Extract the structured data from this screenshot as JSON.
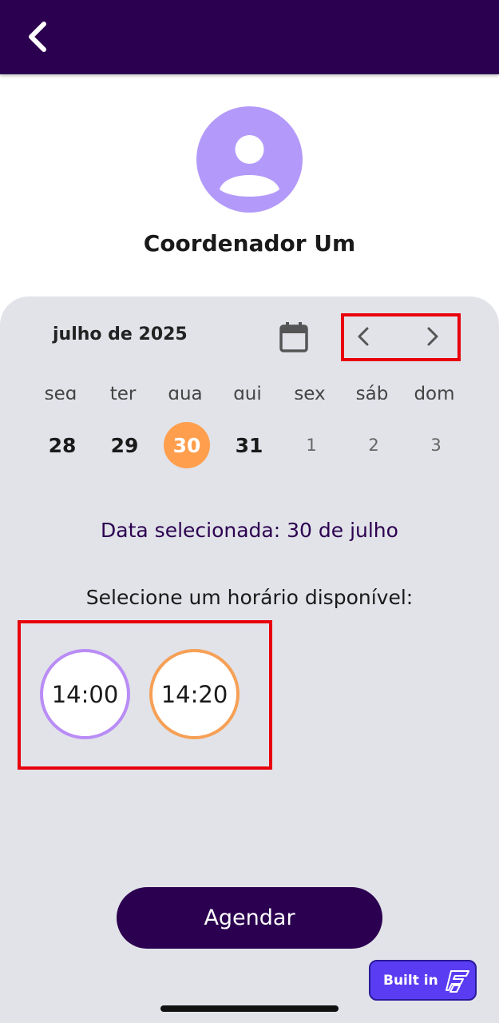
{
  "header": {
    "back_icon": "chevron-left-icon",
    "bg_color": "#2c0050"
  },
  "profile": {
    "avatar_icon": "person-avatar-icon",
    "name": "Coordenador Um"
  },
  "calendar": {
    "month_label": "julho de 2025",
    "calendar_icon": "calendar-icon",
    "prev_icon": "chevron-left-icon",
    "next_icon": "chevron-right-icon",
    "weekdays": [
      "seg",
      "ter",
      "qua",
      "qui",
      "sex",
      "sáb",
      "dom"
    ],
    "days": [
      "28",
      "29",
      "30",
      "31",
      "1",
      "2",
      "3"
    ],
    "selected_day": "30",
    "selected_color": "#ff9f4e"
  },
  "selection": {
    "selected_date_text": "Data selecionada: 30 de julho",
    "time_prompt": "Selecione um horário disponível:"
  },
  "slots": [
    {
      "time": "14:00",
      "ring_color": "#b98cf6"
    },
    {
      "time": "14:20",
      "ring_color": "#f6a056"
    }
  ],
  "actions": {
    "schedule_label": "Agendar"
  },
  "badge": {
    "label": "Built in",
    "icon": "flutterflow-logo-icon"
  }
}
